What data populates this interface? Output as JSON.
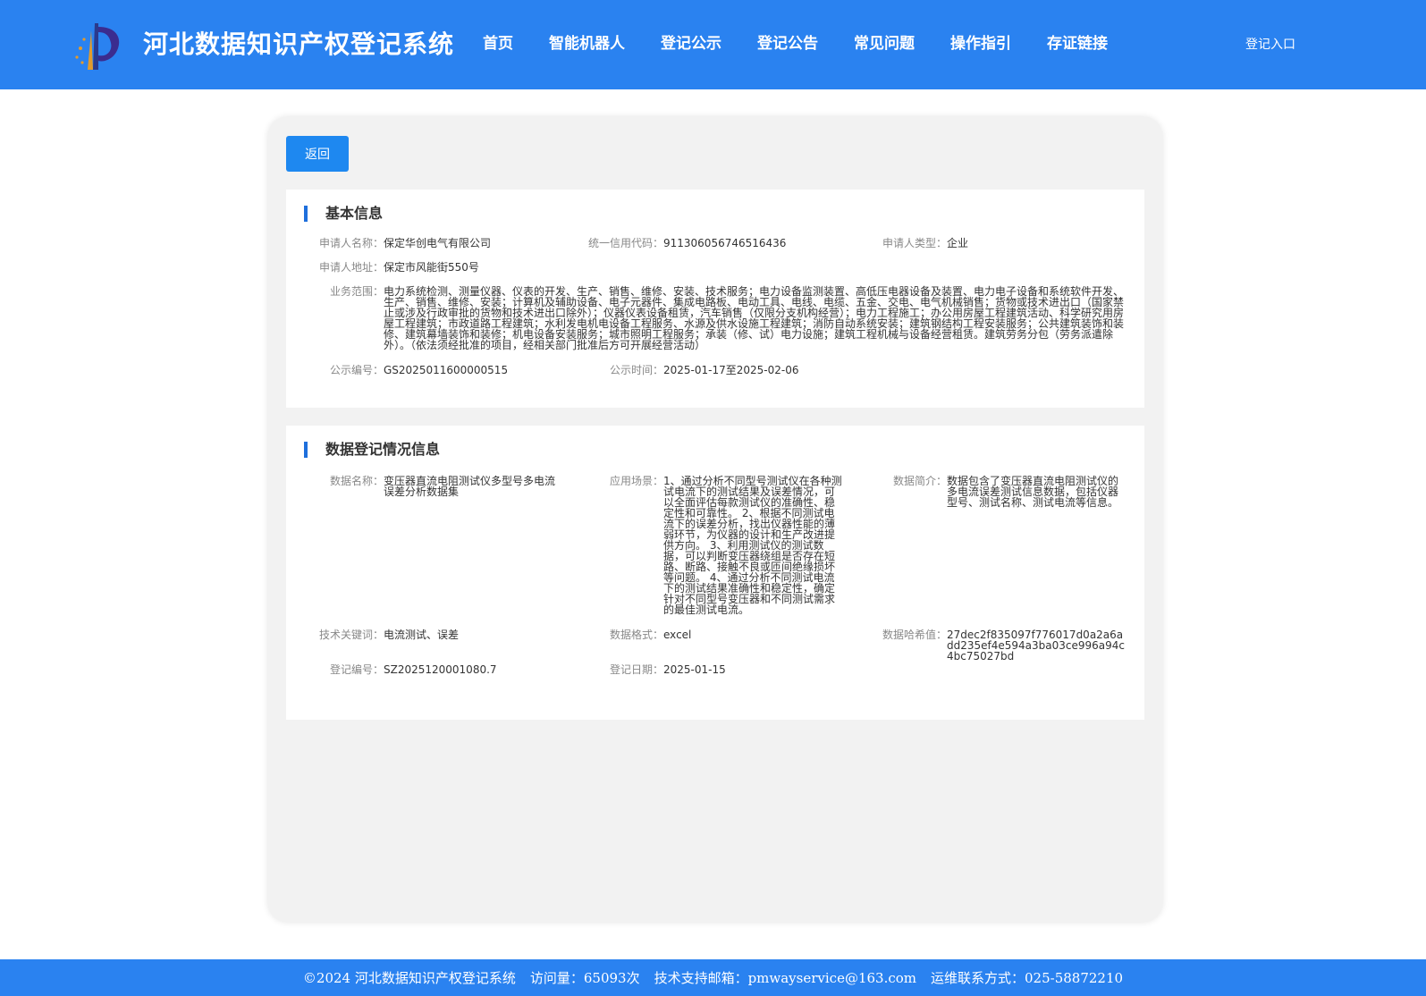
{
  "header": {
    "title": "河北数据知识产权登记系统",
    "nav": [
      "首页",
      "智能机器人",
      "登记公示",
      "登记公告",
      "常见问题",
      "操作指引",
      "存证链接"
    ],
    "login": "登记入口"
  },
  "panel": {
    "back_label": "返回"
  },
  "basic": {
    "title": "基本信息",
    "applicant_name_label": "申请人名称：",
    "applicant_name": "保定华创电气有限公司",
    "credit_code_label": "统一信用代码：",
    "credit_code": "911306056746516436",
    "applicant_type_label": "申请人类型：",
    "applicant_type": "企业",
    "address_label": "申请人地址：",
    "address": "保定市风能街550号",
    "scope_label": "业务范围：",
    "scope": "电力系统检测、测量仪器、仪表的开发、生产、销售、维修、安装、技术服务；电力设备监测装置、高低压电器设备及装置、电力电子设备和系统软件开发、生产、销售、维修、安装；计算机及辅助设备、电子元器件、集成电路板、电动工具、电线、电缆、五金、交电、电气机械销售；货物或技术进出口（国家禁止或涉及行政审批的货物和技术进出口除外）；仪器仪表设备租赁，汽车销售（仅限分支机构经营）；电力工程施工；办公用房屋工程建筑活动、科学研究用房屋工程建筑；市政道路工程建筑；水利发电机电设备工程服务、水源及供水设施工程建筑；消防自动系统安装；建筑钢结构工程安装服务；公共建筑装饰和装修、建筑幕墙装饰和装修；机电设备安装服务；城市照明工程服务；承装（修、试）电力设施；建筑工程机械与设备经营租赁。建筑劳务分包（劳务派遣除外）。（依法须经批准的项目，经相关部门批准后方可开展经营活动）",
    "notice_no_label": "公示编号：",
    "notice_no": "GS2025011600000515",
    "notice_time_label": "公示时间：",
    "notice_time": "2025-01-17至2025-02-06"
  },
  "data_reg": {
    "title": "数据登记情况信息",
    "data_name_label": "数据名称：",
    "data_name": "变压器直流电阻测试仪多型号多电流误差分析数据集",
    "scenario_label": "应用场景：",
    "scenario": "1、通过分析不同型号测试仪在各种测试电流下的测试结果及误差情况，可以全面评估每款测试仪的准确性、稳定性和可靠性。 2、根据不同测试电流下的误差分析，找出仪器性能的薄弱环节，为仪器的设计和生产改进提供方向。 3、利用测试仪的测试数据，可以判断变压器绕组是否存在短路、断路、接触不良或匝间绝缘损坏等问题。 4、通过分析不同测试电流下的测试结果准确性和稳定性，确定针对不同型号变压器和不同测试需求的最佳测试电流。",
    "intro_label": "数据简介：",
    "intro": "数据包含了变压器直流电阻测试仪的多电流误差测试信息数据，包括仪器型号、测试名称、测试电流等信息。",
    "keywords_label": "技术关键词：",
    "keywords": "电流测试、误差",
    "format_label": "数据格式：",
    "format": "excel",
    "hash_label": "数据哈希值：",
    "hash": "27dec2f835097f776017d0a2a6add235ef4e594a3ba03ce996a94c4bc75027bd",
    "reg_no_label": "登记编号：",
    "reg_no": "SZ2025120001080.7",
    "reg_date_label": "登记日期：",
    "reg_date": "2025-01-15"
  },
  "footer": {
    "copyright": "©2024 河北数据知识产权登记系统",
    "visits": "访问量：65093次",
    "email": "技术支持邮箱：pmwayservice@163.com",
    "phone": "运维联系方式：025-58872210"
  },
  "colors": {
    "header_bg": "#2a82f0",
    "button_bg": "#1e88f0",
    "section_bar": "#1e6fdc",
    "panel_bg": "#f2f2f2"
  }
}
